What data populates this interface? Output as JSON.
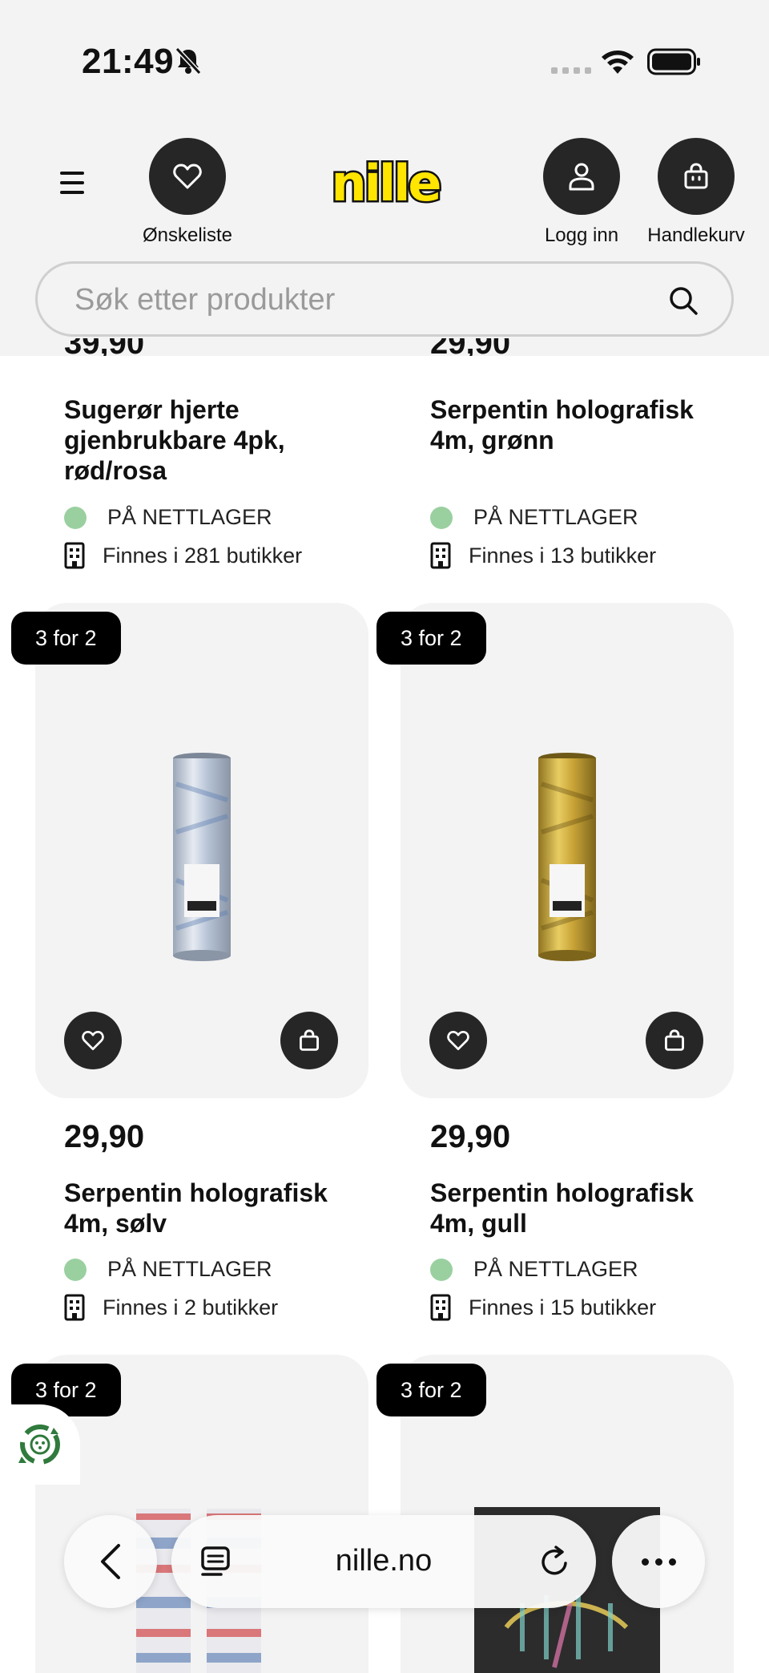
{
  "status_bar": {
    "time": "21:49"
  },
  "header": {
    "wishlist_label": "Ønskeliste",
    "login_label": "Logg inn",
    "cart_label": "Handlekurv",
    "logo_text": "nille"
  },
  "search": {
    "placeholder": "Søk etter produkter"
  },
  "products": [
    {
      "price": "39,90",
      "name": "Sugerør hjerte gjenbrukbare 4pk, rød/rosa",
      "stock": "PÅ NETTLAGER",
      "stores": "Finnes i 281 butikker"
    },
    {
      "price": "29,90",
      "name": "Serpentin holografisk 4m, grønn",
      "stock": "PÅ NETTLAGER",
      "stores": "Finnes i 13 butikker"
    },
    {
      "badge": "3 for 2",
      "price": "29,90",
      "name": "Serpentin holografisk 4m, sølv",
      "stock": "PÅ NETTLAGER",
      "stores": "Finnes i 2 butikker",
      "color": "#c9cfd8"
    },
    {
      "badge": "3 for 2",
      "price": "29,90",
      "name": "Serpentin holografisk 4m, gull",
      "stock": "PÅ NETTLAGER",
      "stores": "Finnes i 15 butikker",
      "color": "#c9a437"
    },
    {
      "badge": "3 for 2"
    },
    {
      "badge": "3 for 2"
    }
  ],
  "browser": {
    "url": "nille.no"
  },
  "colors": {
    "logo_yellow": "#ffe500",
    "stock_green": "#9ad0a0",
    "dark_button": "#262626"
  }
}
